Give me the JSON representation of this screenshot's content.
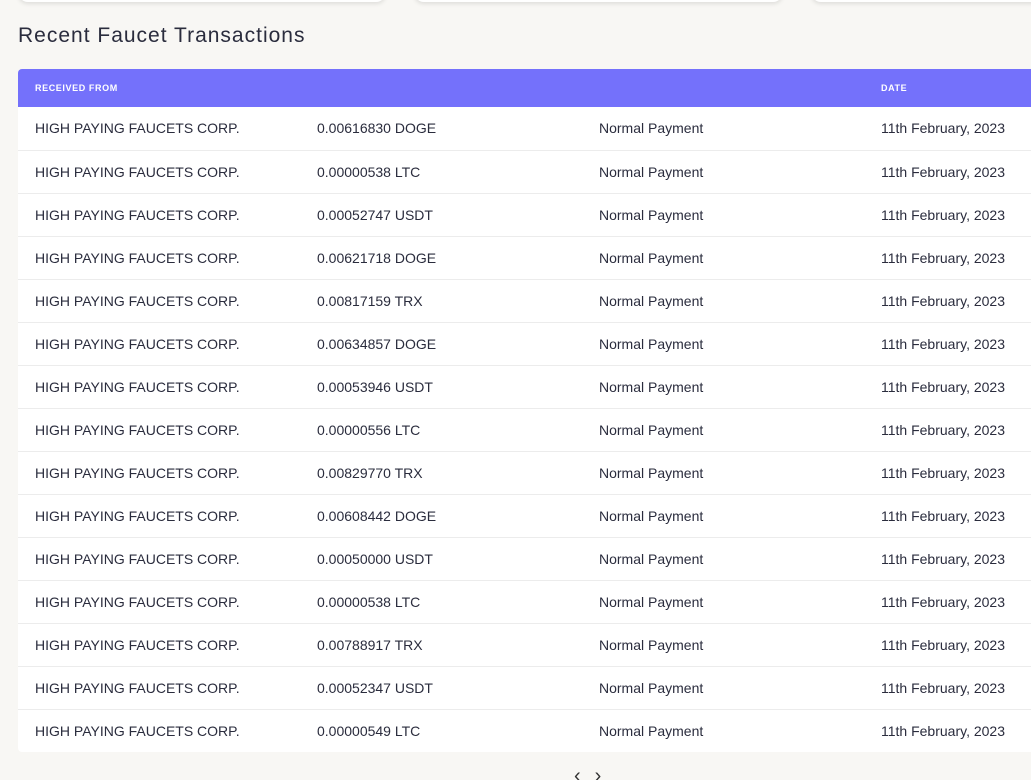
{
  "section": {
    "title": "Recent Faucet Transactions"
  },
  "table": {
    "headers": [
      "RECEIVED FROM",
      "",
      "",
      "DATE"
    ],
    "rows": [
      [
        "HIGH PAYING FAUCETS CORP.",
        "0.00616830 DOGE",
        "Normal Payment",
        "11th February, 2023"
      ],
      [
        "HIGH PAYING FAUCETS CORP.",
        "0.00000538 LTC",
        "Normal Payment",
        "11th February, 2023"
      ],
      [
        "HIGH PAYING FAUCETS CORP.",
        "0.00052747 USDT",
        "Normal Payment",
        "11th February, 2023"
      ],
      [
        "HIGH PAYING FAUCETS CORP.",
        "0.00621718 DOGE",
        "Normal Payment",
        "11th February, 2023"
      ],
      [
        "HIGH PAYING FAUCETS CORP.",
        "0.00817159 TRX",
        "Normal Payment",
        "11th February, 2023"
      ],
      [
        "HIGH PAYING FAUCETS CORP.",
        "0.00634857 DOGE",
        "Normal Payment",
        "11th February, 2023"
      ],
      [
        "HIGH PAYING FAUCETS CORP.",
        "0.00053946 USDT",
        "Normal Payment",
        "11th February, 2023"
      ],
      [
        "HIGH PAYING FAUCETS CORP.",
        "0.00000556 LTC",
        "Normal Payment",
        "11th February, 2023"
      ],
      [
        "HIGH PAYING FAUCETS CORP.",
        "0.00829770 TRX",
        "Normal Payment",
        "11th February, 2023"
      ],
      [
        "HIGH PAYING FAUCETS CORP.",
        "0.00608442 DOGE",
        "Normal Payment",
        "11th February, 2023"
      ],
      [
        "HIGH PAYING FAUCETS CORP.",
        "0.00050000 USDT",
        "Normal Payment",
        "11th February, 2023"
      ],
      [
        "HIGH PAYING FAUCETS CORP.",
        "0.00000538 LTC",
        "Normal Payment",
        "11th February, 2023"
      ],
      [
        "HIGH PAYING FAUCETS CORP.",
        "0.00788917 TRX",
        "Normal Payment",
        "11th February, 2023"
      ],
      [
        "HIGH PAYING FAUCETS CORP.",
        "0.00052347 USDT",
        "Normal Payment",
        "11th February, 2023"
      ],
      [
        "HIGH PAYING FAUCETS CORP.",
        "0.00000549 LTC",
        "Normal Payment",
        "11th February, 2023"
      ]
    ]
  },
  "pagination": {
    "prev_label": "‹",
    "next_label": "›"
  },
  "colors": {
    "header_bg": "#7471fb",
    "page_bg": "#f8f7f4"
  }
}
